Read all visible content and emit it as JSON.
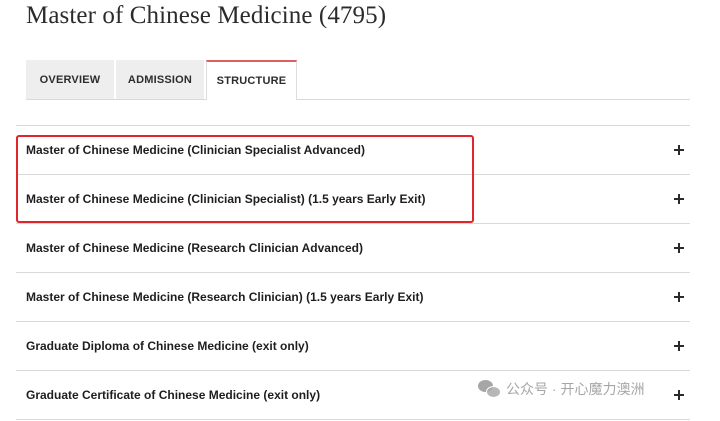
{
  "page": {
    "title": "Master of Chinese Medicine (4795)"
  },
  "tabs": [
    {
      "label": "OVERVIEW",
      "active": false
    },
    {
      "label": "ADMISSION",
      "active": false
    },
    {
      "label": "STRUCTURE",
      "active": true
    }
  ],
  "colors": {
    "active_tab_accent": "#e06060",
    "highlight_box": "#e0262a"
  },
  "structure": {
    "items": [
      {
        "label": "Master of Chinese Medicine (Clinician Specialist Advanced)",
        "icon": "plus-icon"
      },
      {
        "label": "Master of Chinese Medicine (Clinician Specialist) (1.5 years Early Exit)",
        "icon": "plus-icon"
      },
      {
        "label": "Master of Chinese Medicine (Research Clinician Advanced)",
        "icon": "plus-icon"
      },
      {
        "label": "Master of Chinese Medicine (Research Clinician) (1.5 years Early Exit)",
        "icon": "plus-icon"
      },
      {
        "label": "Graduate Diploma of Chinese Medicine (exit only)",
        "icon": "plus-icon"
      },
      {
        "label": "Graduate Certificate of Chinese Medicine (exit only)",
        "icon": "plus-icon"
      }
    ]
  },
  "watermark": {
    "icon": "wechat-icon",
    "text": "公众号 · 开心魔力澳洲"
  }
}
